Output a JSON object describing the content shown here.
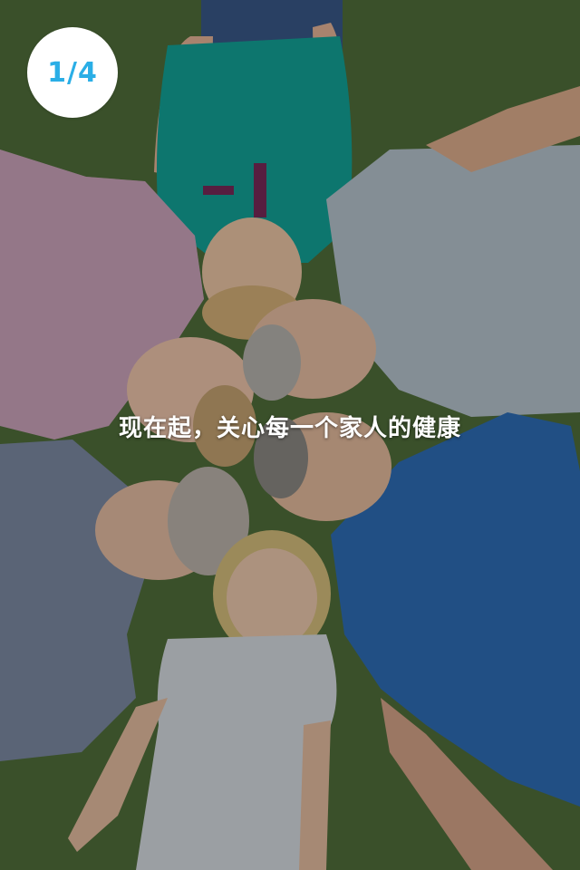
{
  "onboarding": {
    "page_indicator": "1/4",
    "tagline": "现在起，关心每一个家人的健康",
    "photo_desc": "family-lying-on-grass-photo"
  },
  "colors": {
    "indicator_bg": "#ffffff",
    "indicator_text": "#2aaee6",
    "tagline_text": "#ffffff",
    "grass": "#4e6b3a"
  }
}
